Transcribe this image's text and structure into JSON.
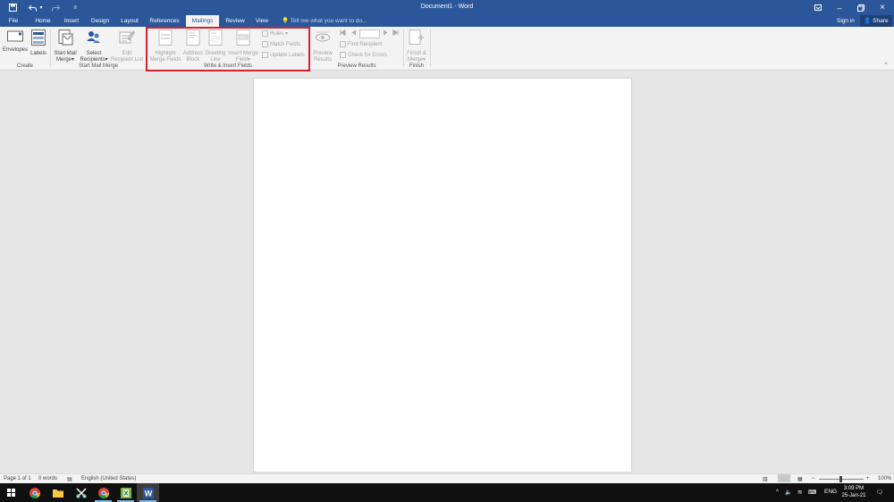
{
  "titlebar": {
    "doc_title": "Document1 - Word",
    "undo_icon": "undo-icon",
    "redo_icon": "redo-icon"
  },
  "tabs": {
    "file": "File",
    "home": "Home",
    "insert": "Insert",
    "design": "Design",
    "layout": "Layout",
    "references": "References",
    "mailings": "Mailings",
    "review": "Review",
    "view": "View"
  },
  "tell_me": "Tell me what you want to do...",
  "sign_in": "Sign in",
  "share": "Share",
  "ribbon": {
    "create": {
      "label": "Create",
      "envelopes": "Envelopes",
      "labels": "Labels"
    },
    "start_mail_merge": {
      "label": "Start Mail Merge",
      "start_line1": "Start Mail",
      "start_line2": "Merge",
      "select_line1": "Select",
      "select_line2": "Recipients",
      "edit_line1": "Edit",
      "edit_line2": "Recipient List"
    },
    "write_insert": {
      "label": "Write & Insert Fields",
      "highlight_line1": "Highlight",
      "highlight_line2": "Merge Fields",
      "address_line1": "Address",
      "address_line2": "Block",
      "greeting_line1": "Greeting",
      "greeting_line2": "Line",
      "insert_line1": "Insert Merge",
      "insert_line2": "Field",
      "rules": "Rules",
      "match_fields": "Match Fields",
      "update_labels": "Update Labels"
    },
    "preview": {
      "label": "Preview Results",
      "preview_line1": "Preview",
      "preview_line2": "Results",
      "find_recipient": "Find Recipient",
      "check_errors": "Check for Errors",
      "record_value": ""
    },
    "finish": {
      "label": "Finish",
      "finish_line1": "Finish &",
      "finish_line2": "Merge"
    }
  },
  "status": {
    "page": "Page 1 of 1",
    "words": "0 words",
    "language": "English (United States)",
    "zoom": "100%"
  },
  "taskbar": {
    "time": "3:09 PM",
    "date": "25-Jan-21",
    "lang": "ENG"
  },
  "colors": {
    "accent": "#2b579a",
    "highlight_box": "#d2232a"
  }
}
